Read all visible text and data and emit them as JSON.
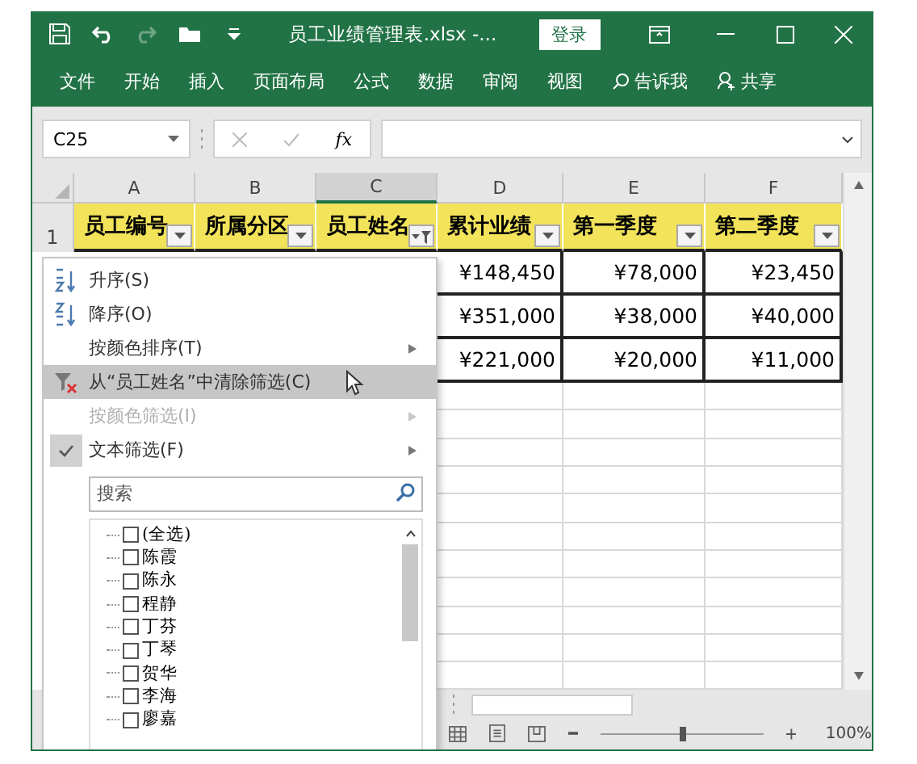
{
  "title_bar": {
    "title": "员工业绩管理表.xlsx -...",
    "login": "登录"
  },
  "ribbon": {
    "tabs": [
      "文件",
      "开始",
      "插入",
      "页面布局",
      "公式",
      "数据",
      "审阅",
      "视图"
    ],
    "tell_me": "告诉我",
    "share": "共享"
  },
  "formula_bar": {
    "name_box": "C25",
    "function_label": "fx"
  },
  "sheet": {
    "columns": [
      {
        "label": "A",
        "selected": false
      },
      {
        "label": "B",
        "selected": false
      },
      {
        "label": "C",
        "selected": true
      },
      {
        "label": "D",
        "selected": false
      },
      {
        "label": "E",
        "selected": false
      },
      {
        "label": "F",
        "selected": false
      }
    ],
    "row_number": "1",
    "headers": [
      {
        "text": "员工编号",
        "filtered": false
      },
      {
        "text": "所属分区",
        "filtered": false
      },
      {
        "text": "员工姓名",
        "filtered": true
      },
      {
        "text": "累计业绩",
        "filtered": false
      },
      {
        "text": "第一季度",
        "filtered": false
      },
      {
        "text": "第二季度",
        "filtered": false
      }
    ],
    "rows": [
      [
        "¥148,450",
        "¥78,000",
        "¥23,450"
      ],
      [
        "¥351,000",
        "¥38,000",
        "¥40,000"
      ],
      [
        "¥221,000",
        "¥20,000",
        "¥11,000"
      ]
    ]
  },
  "filter_menu": {
    "items": [
      {
        "kind": "sort_asc",
        "label": "升序(S)",
        "disabled": false,
        "highlighted": false,
        "checked": false,
        "submenu": false
      },
      {
        "kind": "sort_desc",
        "label": "降序(O)",
        "disabled": false,
        "highlighted": false,
        "checked": false,
        "submenu": false
      },
      {
        "kind": "plain",
        "label": "按颜色排序(T)",
        "disabled": false,
        "highlighted": false,
        "checked": false,
        "submenu": true
      },
      {
        "kind": "clear_filter",
        "label": "从“员工姓名”中清除筛选(C)",
        "disabled": false,
        "highlighted": true,
        "checked": false,
        "submenu": false
      },
      {
        "kind": "plain",
        "label": "按颜色筛选(I)",
        "disabled": true,
        "highlighted": false,
        "checked": false,
        "submenu": true
      },
      {
        "kind": "plain",
        "label": "文本筛选(F)",
        "disabled": false,
        "highlighted": false,
        "checked": true,
        "submenu": true
      }
    ],
    "search_placeholder": "搜索",
    "values": [
      {
        "label": "(全选)",
        "checked": false
      },
      {
        "label": "陈霞",
        "checked": false
      },
      {
        "label": "陈永",
        "checked": false
      },
      {
        "label": "程静",
        "checked": false
      },
      {
        "label": "丁芬",
        "checked": false
      },
      {
        "label": "丁琴",
        "checked": false
      },
      {
        "label": "贺华",
        "checked": false
      },
      {
        "label": "李海",
        "checked": false
      },
      {
        "label": "廖嘉",
        "checked": false
      }
    ]
  },
  "status_bar": {
    "zoom": "100%",
    "zoom_slider": {
      "level": 0.5
    }
  }
}
